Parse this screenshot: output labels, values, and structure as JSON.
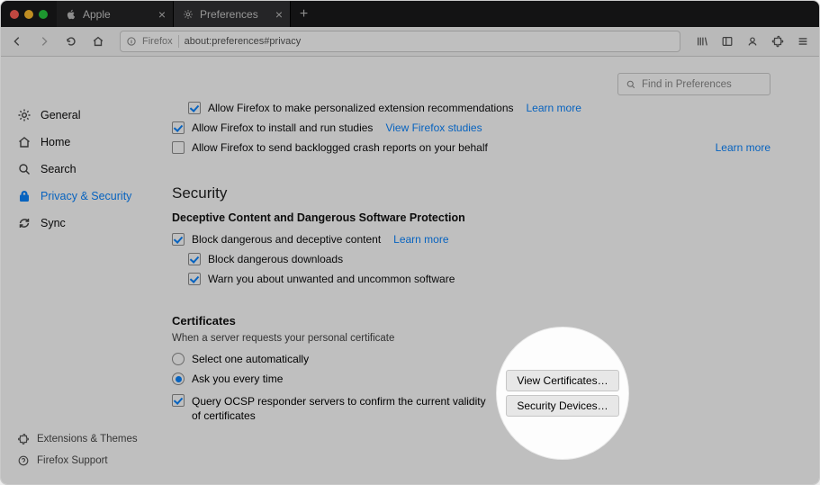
{
  "tabs": {
    "apple": "Apple",
    "prefs": "Preferences"
  },
  "url": {
    "identity": "Firefox",
    "address": "about:preferences#privacy"
  },
  "search": {
    "placeholder": "Find in Preferences"
  },
  "sidebar": {
    "general": "General",
    "home": "Home",
    "search": "Search",
    "privacy": "Privacy & Security",
    "sync": "Sync"
  },
  "footer": {
    "ext": "Extensions & Themes",
    "support": "Firefox Support"
  },
  "collect": {
    "rec": "Allow Firefox to make personalized extension recommendations",
    "rec_link": "Learn more",
    "studies": "Allow Firefox to install and run studies",
    "studies_link": "View Firefox studies",
    "crash": "Allow Firefox to send backlogged crash reports on your behalf",
    "crash_link": "Learn more"
  },
  "security": {
    "heading": "Security",
    "sub": "Deceptive Content and Dangerous Software Protection",
    "block": "Block dangerous and deceptive content",
    "block_link": "Learn more",
    "downloads": "Block dangerous downloads",
    "warn": "Warn you about unwanted and uncommon software"
  },
  "certs": {
    "heading": "Certificates",
    "when": "When a server requests your personal certificate",
    "r1": "Select one automatically",
    "r2": "Ask you every time",
    "ocsp": "Query OCSP responder servers to confirm the current validity of certificates",
    "btn_view": "View Certificates…",
    "btn_dev": "Security Devices…"
  }
}
